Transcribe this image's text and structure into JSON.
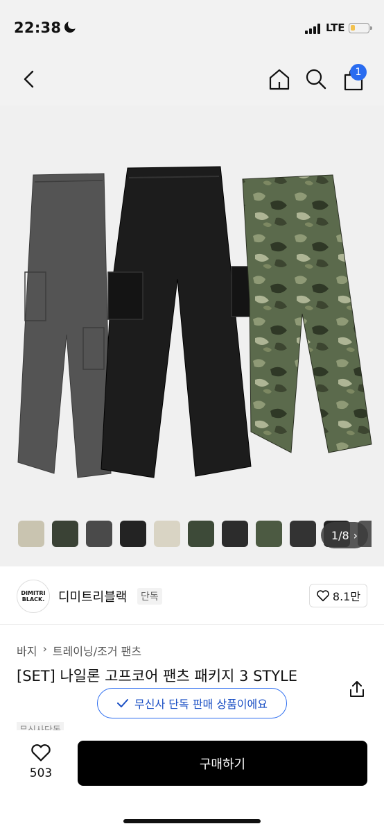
{
  "status_bar": {
    "time": "22:38",
    "network": "LTE",
    "battery_level": 0.25,
    "battery_color": "#f2c14e"
  },
  "nav": {
    "cart_count": "1",
    "badge_color": "#2a6cf0"
  },
  "gallery": {
    "counter": "1/8",
    "swatch_colors": [
      "#c9c4b0",
      "#3a4235",
      "#4a4a4a",
      "#232323",
      "#d9d4c4",
      "#3d4a38",
      "#2c2c2c",
      "#4c5a42",
      "#333333",
      "#222222",
      "#555555"
    ],
    "product_colors": [
      "#545454",
      "#1c1c1c",
      "#55654a"
    ]
  },
  "brand": {
    "logo_text": "DIMITRI BLACK.",
    "name": "디미트리블랙",
    "tag": "단독",
    "likes": "8.1만"
  },
  "product": {
    "breadcrumb": [
      "바지",
      "트레이닝/조거 팬츠"
    ],
    "title": "[SET] 나일론 고프코어 팬츠 패키지 3 STYLE",
    "exclusive_notice": "무신사 단독 판매 상품이에요",
    "hidden_tag": "무신사단독"
  },
  "bottom_bar": {
    "wish_count": "503",
    "buy_label": "구매하기"
  }
}
